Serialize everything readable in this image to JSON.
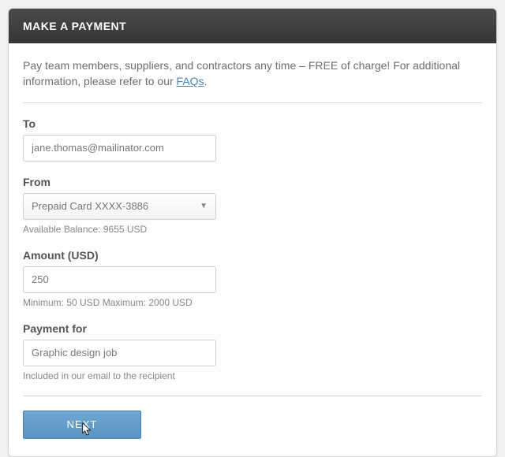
{
  "header": {
    "title": "MAKE A PAYMENT"
  },
  "intro": {
    "text": "Pay team members, suppliers, and contractors any time – FREE of charge! For additional information, please refer to our ",
    "link_label": "FAQs",
    "suffix": "."
  },
  "to": {
    "label": "To",
    "value": "jane.thomas@mailinator.com"
  },
  "from": {
    "label": "From",
    "selected": "Prepaid Card XXXX-3886",
    "balance_hint": "Available Balance: 9655 USD"
  },
  "amount": {
    "label": "Amount (USD)",
    "value": "250",
    "range_hint": "Minimum: 50 USD   Maximum: 2000 USD"
  },
  "payment_for": {
    "label": "Payment for",
    "value": "Graphic design job",
    "hint": "Included in our email to the recipient"
  },
  "buttons": {
    "next": "NEXT"
  }
}
